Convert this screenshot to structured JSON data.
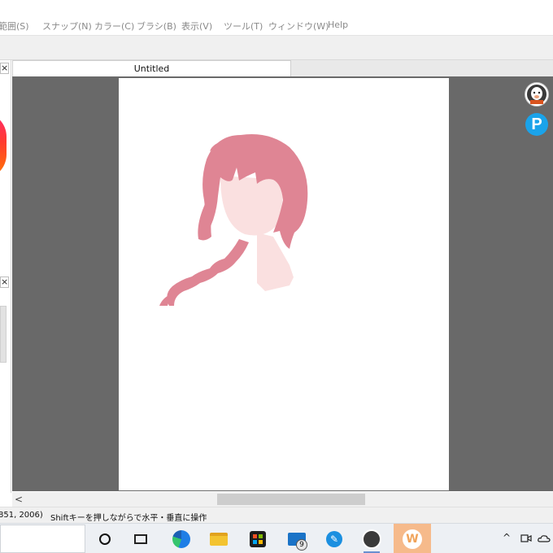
{
  "menu": {
    "items": [
      "範囲(S)",
      "スナップ(N)",
      "カラー(C)",
      "ブラシ(B)",
      "表示(V)",
      "ツール(T)",
      "ウィンドウ(W)",
      "Help"
    ]
  },
  "left_panel": {
    "close_glyph": "×"
  },
  "document": {
    "tab_title": "Untitled"
  },
  "side_icons": {
    "pixiv_letter": "P"
  },
  "scrollbar": {
    "left_arrow": "<"
  },
  "status": {
    "coords": "851, 2006)",
    "hint": "Shiftキーを押しながらで水平・垂直に操作"
  },
  "taskbar": {
    "mail_badge": "9",
    "active_app_letter": "W",
    "pen_app_glyph": "✎",
    "tray_chevron": "^"
  },
  "colors": {
    "hair": "#df8594",
    "skin": "#fae0e0",
    "workspace": "#696969",
    "pixiv_blue": "#1aa3ea",
    "active_app": "#f6ba8b"
  }
}
